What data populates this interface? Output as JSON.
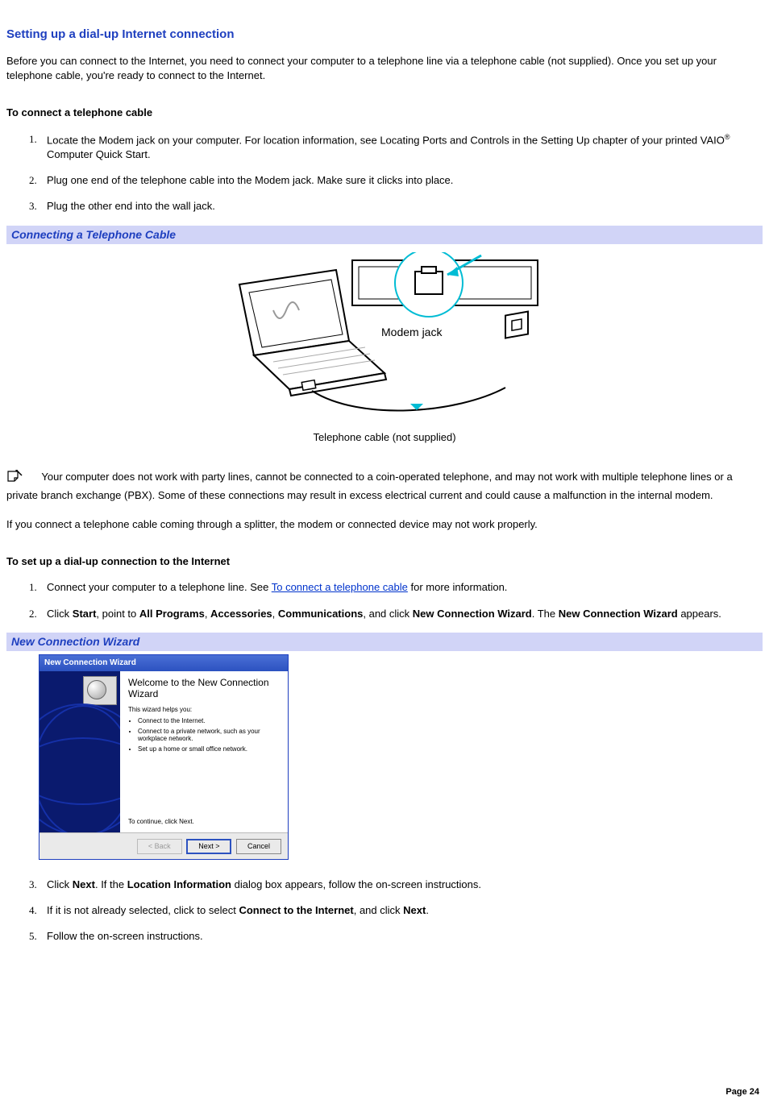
{
  "title": "Setting up a dial-up Internet connection",
  "intro": "Before you can connect to the Internet, you need to connect your computer to a telephone line via a telephone cable (not supplied). Once you set up your telephone cable, you're ready to connect to the Internet.",
  "section1": {
    "heading": "To connect a telephone cable",
    "items": {
      "1": {
        "pre": "Locate the Modem jack on your computer. For location information, see Locating Ports and Controls in the Setting Up chapter of your printed VAIO",
        "reg": "®",
        "post": " Computer Quick Start."
      },
      "2": "Plug one end of the telephone cable into the Modem jack. Make sure it clicks into place.",
      "3": "Plug the other end into the wall jack."
    }
  },
  "figure1": {
    "caption": "Connecting a Telephone Cable",
    "jack_label": "Modem jack",
    "cable_label": "Telephone cable (not supplied)"
  },
  "note1": "Your computer does not work with party lines, cannot be connected to a coin-operated telephone, and may not work with multiple telephone lines or a private branch exchange (PBX). Some of these connections may result in excess electrical current and could cause a malfunction in the internal modem.",
  "note2": "If you connect a telephone cable coming through a splitter, the modem or connected device may not work properly.",
  "section2": {
    "heading": "To set up a dial-up connection to the Internet",
    "items": {
      "1": {
        "pre": "Connect your computer to a telephone line. See ",
        "link": "To connect a telephone cable",
        "post": " for more information."
      },
      "2": {
        "t1": "Click ",
        "b1": "Start",
        "t2": ", point to ",
        "b2": "All Programs",
        "t3": ", ",
        "b3": "Accessories",
        "t4": ", ",
        "b4": "Communications",
        "t5": ", and click ",
        "b5": "New Connection Wizard",
        "t6": ". The ",
        "b6": "New Connection Wizard",
        "t7": " appears."
      },
      "3": {
        "t1": "Click ",
        "b1": "Next",
        "t2": ". If the ",
        "b2": "Location Information",
        "t3": " dialog box appears, follow the on-screen instructions."
      },
      "4": {
        "t1": "If it is not already selected, click to select ",
        "b1": "Connect to the Internet",
        "t2": ", and click ",
        "b2": "Next",
        "t3": "."
      },
      "5": "Follow the on-screen instructions."
    }
  },
  "figure2": {
    "caption": "New Connection Wizard",
    "window_title": "New Connection Wizard",
    "welcome": "Welcome to the New Connection Wizard",
    "helps": "This wizard helps you:",
    "bullets": {
      "0": "Connect to the Internet.",
      "1": "Connect to a private network, such as your workplace network.",
      "2": "Set up a home or small office network."
    },
    "continue": "To continue, click Next.",
    "buttons": {
      "back": "< Back",
      "next": "Next >",
      "cancel": "Cancel"
    }
  },
  "page_label": "Page 24"
}
